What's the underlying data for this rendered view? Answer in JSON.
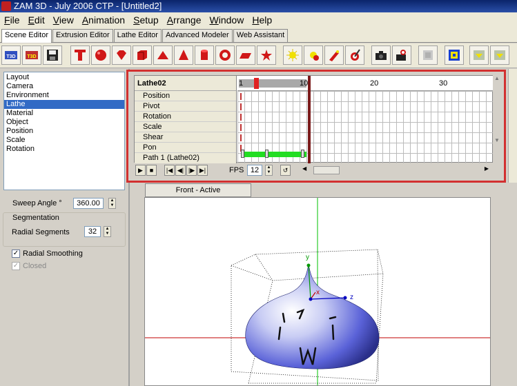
{
  "window": {
    "title": "ZAM 3D - July 2006 CTP - [Untitled2]"
  },
  "menu": [
    "File",
    "Edit",
    "View",
    "Animation",
    "Setup",
    "Arrange",
    "Window",
    "Help"
  ],
  "tabs": [
    "Scene Editor",
    "Extrusion Editor",
    "Lathe Editor",
    "Advanced Modeler",
    "Web Assistant"
  ],
  "toolbar": {
    "t3d_label": "T3D",
    "t3d_label_2": "T3D"
  },
  "left_panel": {
    "list_items": [
      "Layout",
      "Camera",
      "Environment",
      "Lathe",
      "Material",
      "Object",
      "Position",
      "Scale",
      "Rotation"
    ],
    "selected_item": "Lathe",
    "sweep_angle_label": "Sweep Angle °",
    "sweep_angle_value": "360.00",
    "segmentation_label": "Segmentation",
    "radial_segments_label": "Radial Segments",
    "radial_segments_value": "32",
    "radial_smoothing_label": "Radial Smoothing",
    "radial_smoothing_checked": true,
    "closed_label": "Closed",
    "closed_checked": true
  },
  "timeline": {
    "object_name": "Lathe02",
    "tracks": [
      "Position",
      "Pivot",
      "Rotation",
      "Scale",
      "Shear",
      "Pon",
      "Path 1 (Lathe02)"
    ],
    "ruler_labels": [
      "1",
      "10",
      "20",
      "30"
    ],
    "fps_label": "FPS",
    "fps_value": "12"
  },
  "viewport": {
    "tab_label": "Front - Active",
    "axis_labels": {
      "y": "y",
      "z": "z",
      "x": "x"
    }
  },
  "colors": {
    "timeline_highlight": "#d23030",
    "path_bar": "#22dd22",
    "axis_green": "#00c000",
    "axis_red": "#c00000",
    "model_blue": "#5a62d8"
  }
}
